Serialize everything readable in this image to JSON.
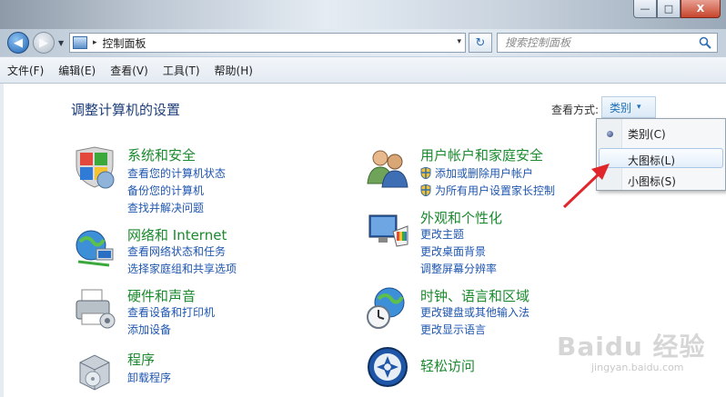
{
  "window": {
    "min_label": "—",
    "max_label": "□",
    "close_label": "X"
  },
  "address": {
    "crumb": "控制面板",
    "separator": "▸",
    "drop": "▾"
  },
  "refresh_label": "↻",
  "search": {
    "placeholder": "搜索控制面板"
  },
  "menubar": [
    "文件(F)",
    "编辑(E)",
    "查看(V)",
    "工具(T)",
    "帮助(H)"
  ],
  "page_title": "调整计算机的设置",
  "viewby": {
    "label": "查看方式:",
    "value": "类别",
    "caret": "▾"
  },
  "categories": [
    {
      "title": "系统和安全",
      "links": [
        "查看您的计算机状态",
        "备份您的计算机",
        "查找并解决问题"
      ]
    },
    {
      "title": "网络和 Internet",
      "links": [
        "查看网络状态和任务",
        "选择家庭组和共享选项"
      ]
    },
    {
      "title": "硬件和声音",
      "links": [
        "查看设备和打印机",
        "添加设备"
      ]
    },
    {
      "title": "程序",
      "links": [
        "卸载程序"
      ]
    },
    {
      "title": "用户帐户和家庭安全",
      "links": [
        "添加或删除用户帐户",
        "为所有用户设置家长控制"
      ]
    },
    {
      "title": "外观和个性化",
      "links": [
        "更改主题",
        "更改桌面背景",
        "调整屏幕分辨率"
      ]
    },
    {
      "title": "时钟、语言和区域",
      "links": [
        "更改键盘或其他输入法",
        "更改显示语言"
      ]
    },
    {
      "title": "轻松访问",
      "links": []
    }
  ],
  "popup": {
    "options": [
      "类别(C)",
      "大图标(L)",
      "小图标(S)"
    ],
    "selected": "类别(C)",
    "hovered": "大图标(L)"
  },
  "watermark": {
    "brand": "Baidu 经验",
    "url": "jingyan.baidu.com"
  },
  "colors": {
    "category_title": "#1a8a2e",
    "link": "#1e56b0",
    "page_title": "#1e3f7a",
    "annotation_arrow": "#e0262b"
  }
}
